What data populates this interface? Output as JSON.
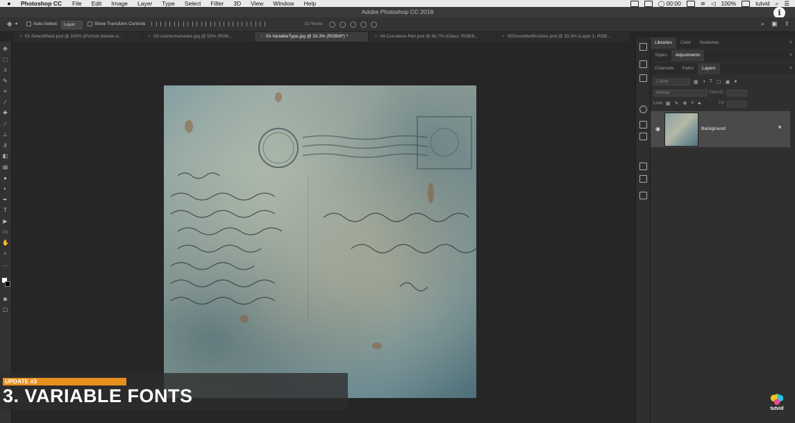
{
  "menubar": {
    "app": "Photoshop CC",
    "items": [
      "File",
      "Edit",
      "Image",
      "Layer",
      "Type",
      "Select",
      "Filter",
      "3D",
      "View",
      "Window",
      "Help"
    ],
    "clock": "00:00",
    "battery": "100%",
    "user": "tutvid"
  },
  "window": {
    "title": "Adobe Photoshop CC 2018"
  },
  "options": {
    "auto_select_label": "Auto-Select:",
    "auto_select_value": "Layer",
    "transform_label": "Show Transform Controls",
    "mode_3d": "3D Mode:"
  },
  "tabs": [
    {
      "label": "01-SelectMask.psd @ 100% (Portrait  blonde w...",
      "active": false
    },
    {
      "label": "02-colorlumamasks.jpg @ 50% (RGB...",
      "active": false
    },
    {
      "label": "03-VariableType.jpg @ 33.3% (RGB/8*) *",
      "active": true
    },
    {
      "label": "04-Curvature-Pen.psd @ 66.7% (Glass, RGB/8...",
      "active": false
    },
    {
      "label": "05SmootherBrushes.psd @ 33.3% (Layer 1, RGB...",
      "active": false
    }
  ],
  "panels": {
    "top_tabs": [
      "Libraries",
      "Color",
      "Swatches"
    ],
    "mid_tabs": [
      "Styles",
      "Adjustments"
    ],
    "layer_tabs": [
      "Channels",
      "Paths",
      "Layers"
    ],
    "kind_placeholder": "Kind",
    "blend_mode": "Normal",
    "opacity_label": "Opacity:",
    "lock_label": "Lock:",
    "fill_label": "Fill:"
  },
  "layer": {
    "name": "Background"
  },
  "overlay": {
    "badge": "UPDATE #3",
    "headline": "3. VARIABLE FONTS"
  },
  "brand": {
    "name": "tutvid"
  }
}
